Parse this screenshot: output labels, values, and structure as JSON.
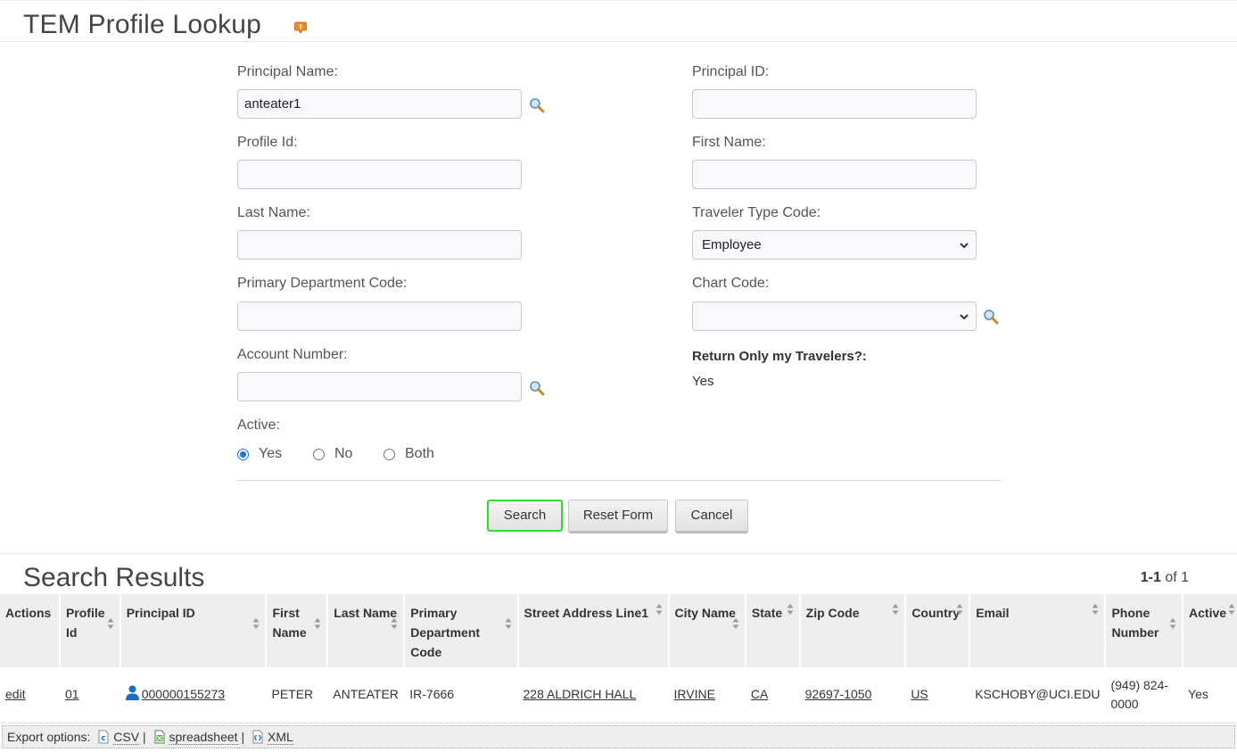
{
  "page": {
    "title": "TEM Profile Lookup",
    "help_icon": "help-icon"
  },
  "form": {
    "principal_name": {
      "label": "Principal Name:",
      "value": "anteater1"
    },
    "principal_id": {
      "label": "Principal ID:",
      "value": ""
    },
    "profile_id": {
      "label": "Profile Id:",
      "value": ""
    },
    "first_name": {
      "label": "First Name:",
      "value": ""
    },
    "last_name": {
      "label": "Last Name:",
      "value": ""
    },
    "traveler_type_code": {
      "label": "Traveler Type Code:",
      "value": "Employee"
    },
    "primary_department_code": {
      "label": "Primary Department Code:",
      "value": ""
    },
    "chart_code": {
      "label": "Chart Code:",
      "value": ""
    },
    "account_number": {
      "label": "Account Number:",
      "value": ""
    },
    "return_only_my_travelers": {
      "label": "Return Only my Travelers?:",
      "value": "Yes"
    },
    "active": {
      "label": "Active:",
      "options": [
        "Yes",
        "No",
        "Both"
      ],
      "selected": "Yes"
    }
  },
  "buttons": {
    "search": "Search",
    "reset": "Reset Form",
    "cancel": "Cancel"
  },
  "results": {
    "title": "Search Results",
    "paging_range": "1-1",
    "paging_total": "of 1",
    "columns": [
      "Actions",
      "Profile Id",
      "Principal ID",
      "First Name",
      "Last Name",
      "Primary Department Code",
      "Street Address Line1",
      "City Name",
      "State",
      "Zip Code",
      "Country",
      "Email",
      "Phone Number",
      "Active"
    ],
    "rows": [
      {
        "action": "edit",
        "profile_id": "01",
        "principal_id": "000000155273",
        "first_name": "PETER",
        "last_name": "ANTEATER",
        "primary_department_code": "IR-7666",
        "street_address": "228 ALDRICH HALL",
        "city": "IRVINE",
        "state": "CA",
        "zip": "92697-1050",
        "country": "US",
        "email": "KSCHOBY@UCI.EDU",
        "phone": "(949) 824-0000",
        "active": "Yes"
      }
    ]
  },
  "export": {
    "label": "Export options:",
    "csv": "CSV",
    "spreadsheet": "spreadsheet",
    "xml": "XML"
  },
  "colors": {
    "search_highlight": "#2ee02e",
    "radio_selected": "#1a73e8",
    "person_icon": "#1a6fc4"
  }
}
